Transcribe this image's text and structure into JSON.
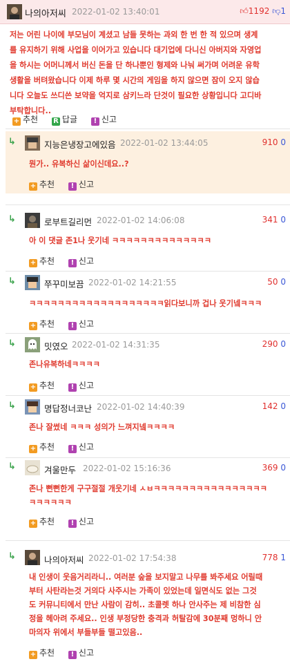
{
  "labels": {
    "recommend": "추천",
    "reply": "답글",
    "report": "신고",
    "reply_icon": "R"
  },
  "post": {
    "username": "나의아저씨",
    "timestamp": "2022-01-02 13:40:01",
    "upvotes": "1192",
    "downvotes": "1",
    "lines": [
      "저는 어린 나이에 부모님이 계셨고 남들 못하는 과외 한 번 한 적 있으며 생계",
      "를 유지하기 위해 사업을 이어가고 있습니다 대기업에 다니신 아버지와 자영업",
      "을 하시는 어머니께서 버신 돈을 단 하나뿐인 형제와 나눠 써가며 어려운 유학",
      "생활을 버텨왔습니다 이제 하루 몇 시간의 게임을 하지 않으면 잠이 오지 않습",
      "니다 오늘도 쓰디쓴 보약을 억지로 삼키느라 단것이 필요한 상황입니다 고디바",
      "부탁합니다.."
    ]
  },
  "comments": [
    {
      "username": "지능은냉장고에있음",
      "timestamp": "2022-01-02 13:44:05",
      "up": "910",
      "down": "0",
      "lines": [
        "뭔가.. 유복하신 삶이신데요..?"
      ]
    },
    {
      "username": "로부트길리먼",
      "timestamp": "2022-01-02 14:06:08",
      "up": "341",
      "down": "0",
      "lines": [
        "아 이 댓글 존1나 웃기네 ㅋㅋㅋㅋㅋㅋㅋㅋㅋㅋㅋㅋㅋㅋ"
      ]
    },
    {
      "username": "쭈꾸미보끔",
      "timestamp": "2022-01-02 14:21:55",
      "up": "50",
      "down": "0",
      "lines": [
        "ㅋㅋㅋㅋㅋㅋㅋㅋㅋㅋㅋㅋㅋㅋㅋㅋㅋㅋㅋ읽다보니까 겁나 웃기넼ㅋㅋㅋ"
      ]
    },
    {
      "username": "밋였오",
      "timestamp": "2022-01-02 14:31:35",
      "up": "290",
      "down": "0",
      "lines": [
        "존나유복하네ㅋㅋㅋㅋ"
      ]
    },
    {
      "username": "명답정너코난",
      "timestamp": "2022-01-02 14:40:39",
      "up": "142",
      "down": "0",
      "lines": [
        "존나 잘썼네 ㅋㅋㅋ 성의가 느껴지넼ㅋㅋㅋㅋ"
      ]
    },
    {
      "username": "겨울만두",
      "timestamp": "2022-01-02 15:16:36",
      "up": "369",
      "down": "0",
      "lines": [
        "존나 뻔뻔한게 구구절절 개웃기네 ㅅㅂㅋㅋㅋㅋㅋㅋㅋㅋㅋㅋㅋㅋㅋㅋㅋㅋ",
        "ㅋㅋㅋㅋㅋㅋ"
      ]
    },
    {
      "username": "나의아저씨",
      "timestamp": "2022-01-02 17:54:38",
      "up": "778",
      "down": "1",
      "lines": [
        "내 인생이 웃음거리라니.. 여러분 숲을 보지말고 나무를 봐주세요 어릴때",
        "부터 사탄라는것 거의다 사주시는 가족이 있었는데 일면식도 없는 그것",
        "도 커뮤니티에서 만난 사람이 감히.. 초콜렛 하나 안사주는 제 비참한 심",
        "정을 헤아려 주세요.. 인생 부정당한 충격과 허탈감에 30분째 멍하니 안",
        "마의자 위에서 부들부들 떨고있음.."
      ]
    }
  ]
}
